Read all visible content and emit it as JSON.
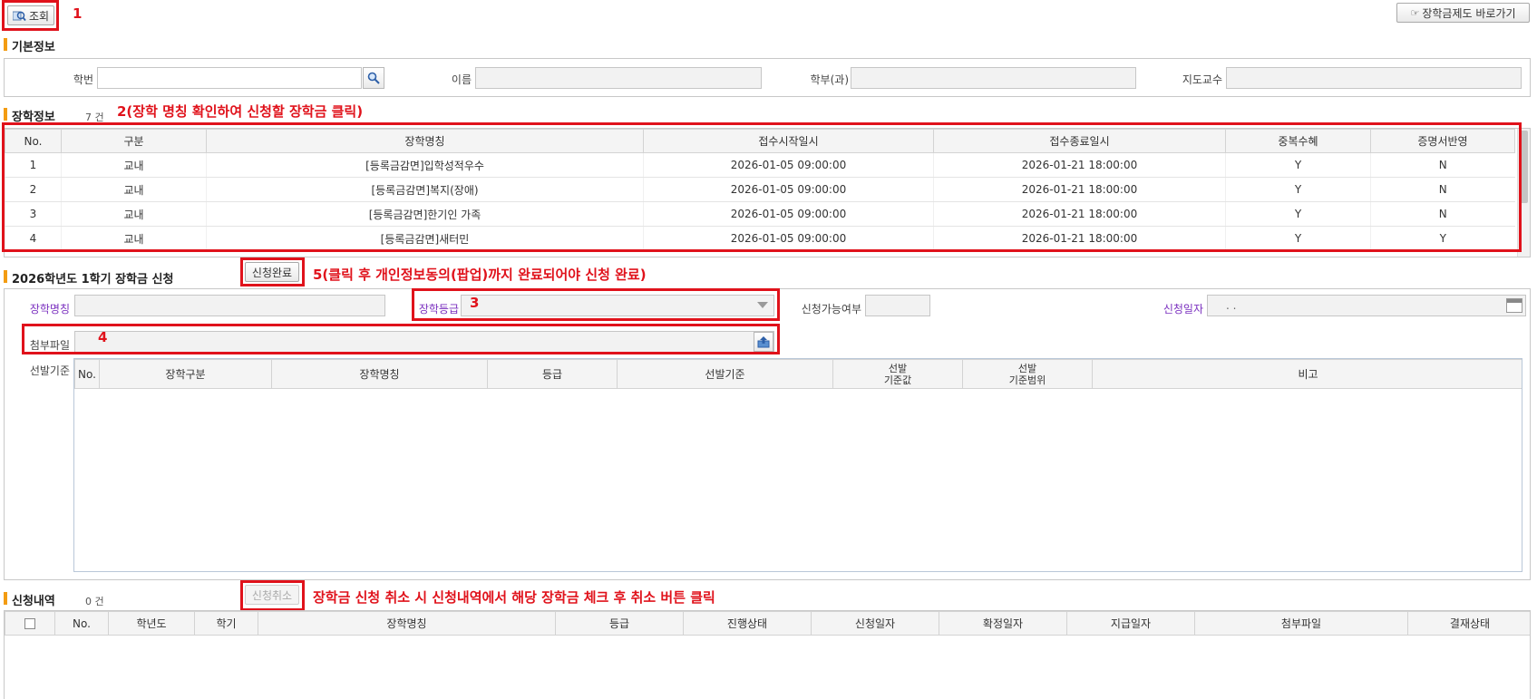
{
  "toolbar": {
    "search_label": "조회",
    "shortcut_label": "장학금제도 바로가기",
    "annotation_1": "1"
  },
  "basic_info": {
    "title": "기본정보",
    "student_id_label": "학번",
    "name_label": "이름",
    "department_label": "학부(과)",
    "advisor_label": "지도교수"
  },
  "scholarship_info": {
    "title": "장학정보",
    "count": "7 건",
    "annotation": "2(장학 명칭 확인하여 신청할 장학금 클릭)",
    "columns": [
      "No.",
      "구분",
      "장학명칭",
      "접수시작일시",
      "접수종료일시",
      "중복수혜",
      "증명서반영"
    ],
    "rows": [
      [
        "1",
        "교내",
        "[등록금감면]입학성적우수",
        "2026-01-05 09:00:00",
        "2026-01-21 18:00:00",
        "Y",
        "N"
      ],
      [
        "2",
        "교내",
        "[등록금감면]복지(장애)",
        "2026-01-05 09:00:00",
        "2026-01-21 18:00:00",
        "Y",
        "N"
      ],
      [
        "3",
        "교내",
        "[등록금감면]한기인 가족",
        "2026-01-05 09:00:00",
        "2026-01-21 18:00:00",
        "Y",
        "N"
      ],
      [
        "4",
        "교내",
        "[등록금감면]새터민",
        "2026-01-05 09:00:00",
        "2026-01-21 18:00:00",
        "Y",
        "Y"
      ]
    ]
  },
  "application": {
    "title": "2026학년도 1학기 장학금 신청",
    "complete_label": "신청완료",
    "annotation_5": "5(클릭 후 개인정보동의(팝업)까지 완료되어야 신청 완료)",
    "name_label": "장학명칭",
    "grade_label": "장학등급",
    "annotation_3": "3",
    "eligibility_label": "신청가능여부",
    "date_label": "신청일자",
    "date_value": ". .",
    "attach_label": "첨부파일",
    "annotation_4": "4",
    "criteria_label": "선발기준",
    "criteria_columns": [
      "No.",
      "장학구분",
      "장학명칭",
      "등급",
      "선발기준",
      "선발\n기준값",
      "선발\n기준범위",
      "비고"
    ]
  },
  "history": {
    "title": "신청내역",
    "count": "0 건",
    "cancel_label": "신청취소",
    "annotation": "장학금 신청 취소 시 신청내역에서 해당 장학금 체크 후 취소 버튼 클릭",
    "columns": [
      "No.",
      "학년도",
      "학기",
      "장학명칭",
      "등급",
      "진행상태",
      "신청일자",
      "확정일자",
      "지급일자",
      "첨부파일",
      "결재상태"
    ]
  },
  "colors": {
    "annotation_red": "#e0121b",
    "section_accent": "#f39c12",
    "required_label": "#7a2fbf"
  }
}
